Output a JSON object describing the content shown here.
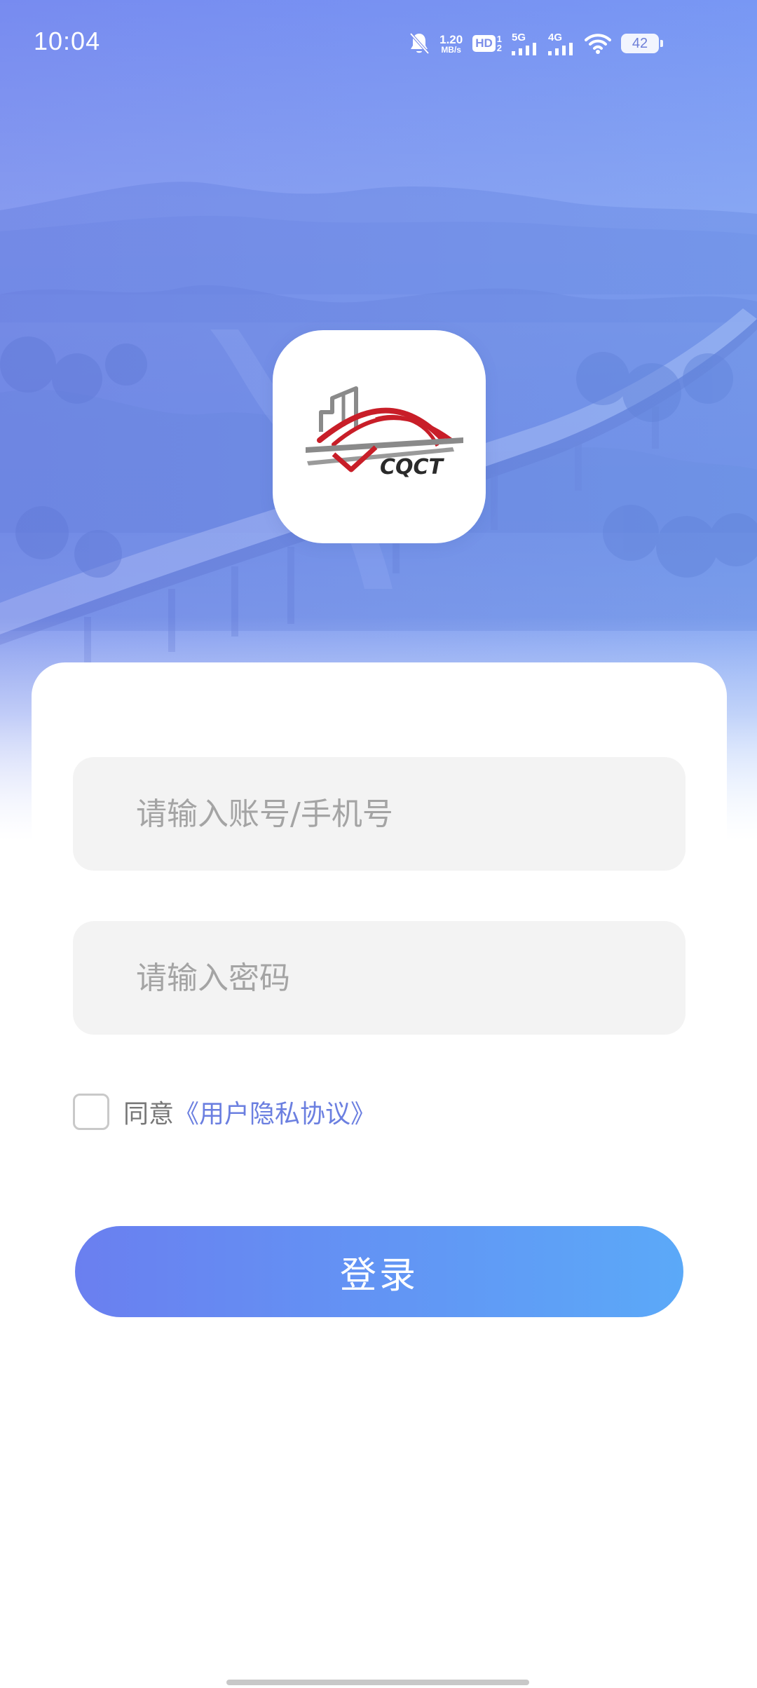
{
  "status_bar": {
    "time": "10:04",
    "net_speed_value": "1.20",
    "net_speed_unit": "MB/s",
    "hd_label": "HD",
    "hd_sub_top": "1",
    "hd_sub_bottom": "2",
    "sim1_label": "5G",
    "sim2_label": "4G",
    "battery": "42",
    "icons": [
      "bell-muted-icon",
      "hd-voice-icon",
      "signal-5g-icon",
      "signal-4g-icon",
      "wifi-icon",
      "battery-icon"
    ]
  },
  "logo": {
    "brand_text": "CQCT",
    "colors": {
      "red": "#c81e28",
      "gray": "#8a8a8a",
      "dark": "#2a2a2a"
    }
  },
  "form": {
    "account_placeholder": "请输入账号/手机号",
    "password_placeholder": "请输入密码",
    "agree_text": "同意",
    "agreement_link": "《用户隐私协议》",
    "agree_checked": false,
    "login_button": "登录"
  },
  "theme": {
    "primary_start": "#6a7ff0",
    "primary_end": "#5ba9f8",
    "link": "#6b7fe0",
    "field_bg": "#f3f3f3"
  }
}
